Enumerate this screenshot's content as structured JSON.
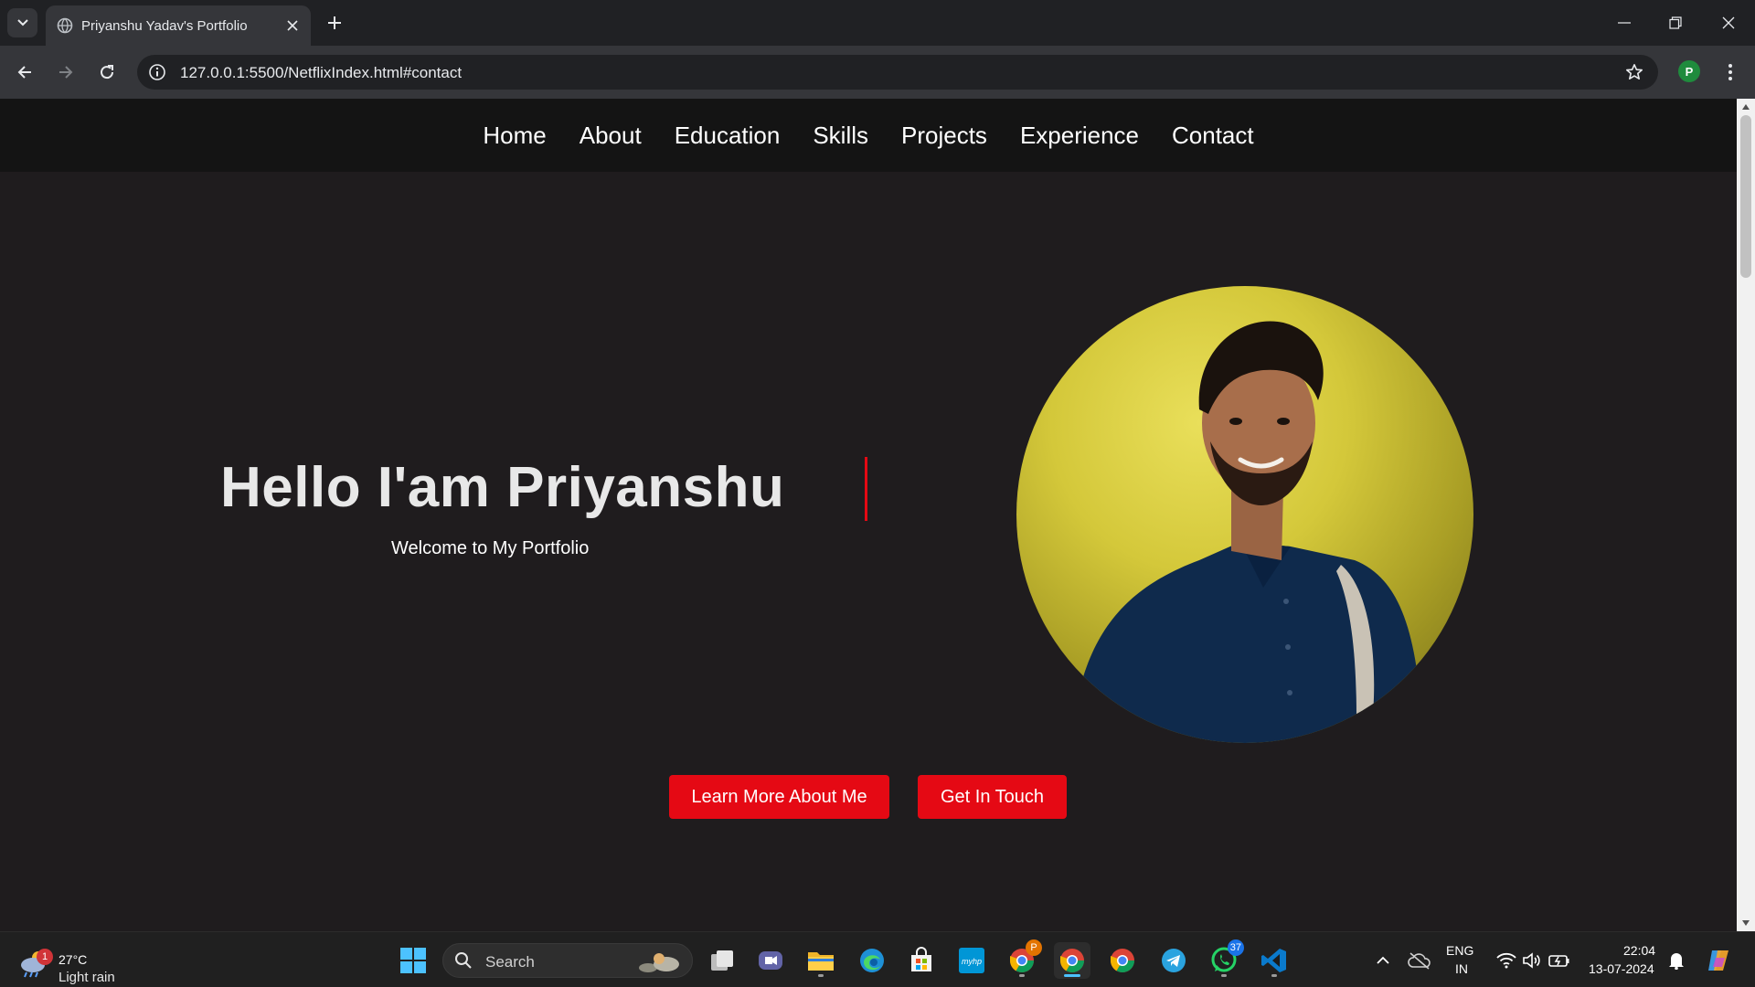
{
  "browser": {
    "tab_title": "Priyanshu Yadav's Portfolio",
    "url": "127.0.0.1:5500/NetflixIndex.html#contact",
    "profile_initial": "P"
  },
  "site": {
    "nav": [
      "Home",
      "About",
      "Education",
      "Skills",
      "Projects",
      "Experience",
      "Contact"
    ],
    "hero_title": "Hello I'am Priyanshu",
    "hero_subtitle": "Welcome to My Portfolio",
    "btn_learn": "Learn More About Me",
    "btn_touch": "Get In Touch",
    "accent_color": "#e50914"
  },
  "taskbar": {
    "weather_temp": "27°C",
    "weather_desc": "Light rain",
    "weather_badge": "1",
    "search_label": "Search",
    "whatsapp_badge": "37",
    "chrome_profile_badge": "P",
    "lang_top": "ENG",
    "lang_bottom": "IN",
    "time": "22:04",
    "date": "13-07-2024"
  }
}
